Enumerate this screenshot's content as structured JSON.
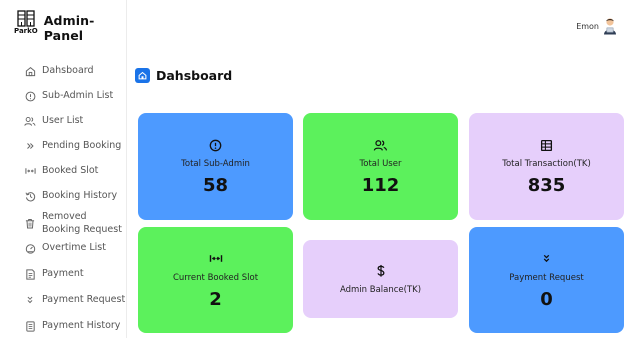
{
  "brand": {
    "logo_text": "ParkO",
    "title": "Admin-Panel"
  },
  "user": {
    "name": "Emon",
    "avatar_icon": "user-avatar-icon"
  },
  "sidebar": {
    "items": [
      {
        "label": "Dahsboard",
        "icon": "home-icon"
      },
      {
        "label": "Sub-Admin List",
        "icon": "info-circle-icon"
      },
      {
        "label": "User List",
        "icon": "users-icon"
      },
      {
        "label": "Pending Booking",
        "icon": "double-chevron-right-icon"
      },
      {
        "label": "Booked Slot",
        "icon": "arrows-in-icon"
      },
      {
        "label": "Booking History",
        "icon": "history-icon"
      },
      {
        "label": "Removed Booking Request",
        "icon": "trash-icon"
      },
      {
        "label": "Overtime List",
        "icon": "gauge-icon"
      },
      {
        "label": "Payment",
        "icon": "invoice-icon"
      },
      {
        "label": "Payment Request",
        "icon": "double-chevron-down-icon"
      },
      {
        "label": "Payment History",
        "icon": "receipt-icon"
      }
    ]
  },
  "page": {
    "title": "Dahsboard"
  },
  "cards": [
    {
      "label": "Total Sub-Admin",
      "value": "58",
      "icon": "info-circle-icon",
      "color": "#4d9aff"
    },
    {
      "label": "Total User",
      "value": "112",
      "icon": "users-icon",
      "color": "#5cf15c"
    },
    {
      "label": "Total Transaction(TK)",
      "value": "835",
      "icon": "ledger-icon",
      "color": "#e6cffb"
    },
    {
      "label": "Current Booked Slot",
      "value": "2",
      "icon": "arrows-in-icon",
      "color": "#5cf15c"
    },
    {
      "label": "Admin Balance(TK)",
      "value": "",
      "icon": "dollar-icon",
      "color": "#e6cffb"
    },
    {
      "label": "Payment Request",
      "value": "0",
      "icon": "double-chevron-down-icon",
      "color": "#4d9aff"
    }
  ],
  "colors": {
    "accent": "#1a73e8",
    "blue_card": "#4d9aff",
    "green_card": "#5cf15c",
    "lavender_card": "#e6cffb"
  }
}
